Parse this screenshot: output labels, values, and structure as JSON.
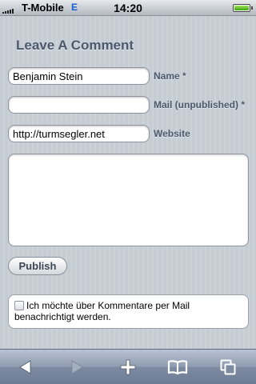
{
  "status_bar": {
    "carrier": "T-Mobile",
    "network": "E",
    "time": "14:20",
    "signal_bars": 5,
    "battery_level": 1.0
  },
  "form": {
    "title": "Leave A Comment",
    "name": {
      "value": "Benjamin Stein",
      "label": "Name *"
    },
    "mail": {
      "value": "",
      "label": "Mail (unpublished) *"
    },
    "website": {
      "value": "http://turmsegler.net",
      "label": "Website"
    },
    "comment": {
      "value": ""
    },
    "publish_label": "Publish",
    "notify": {
      "checked": false,
      "label": "Ich möchte über Kommentare per Mail benachrichtigt werden."
    }
  },
  "toolbar": {
    "buttons": [
      "back-icon",
      "forward-icon",
      "add-icon",
      "bookmarks-icon",
      "pages-icon"
    ],
    "forward_enabled": false
  }
}
